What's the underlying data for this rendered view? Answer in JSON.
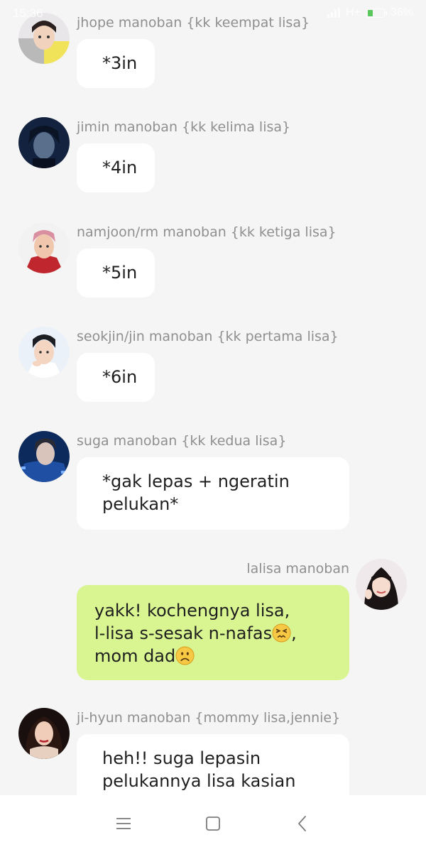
{
  "status_bar": {
    "time": "15:36",
    "network": "H+",
    "battery": "36%",
    "battery_level": 0.36,
    "battery_color": "#3fbf3f"
  },
  "messages": [
    {
      "sender": "jhope manoban {kk keempat lisa}",
      "lines": [
        "*3in"
      ],
      "side": "left",
      "avatar": "avatar-jhope"
    },
    {
      "sender": "jimin manoban {kk kelima lisa}",
      "lines": [
        "*4in"
      ],
      "side": "left",
      "avatar": "avatar-jimin"
    },
    {
      "sender": "namjoon/rm manoban {kk ketiga lisa}",
      "lines": [
        "*5in"
      ],
      "side": "left",
      "avatar": "avatar-namjoon"
    },
    {
      "sender": "seokjin/jin manoban {kk pertama lisa}",
      "lines": [
        "*6in"
      ],
      "side": "left",
      "avatar": "avatar-seokjin"
    },
    {
      "sender": "suga manoban {kk kedua lisa}",
      "lines": [
        "*gak lepas + ngeratin",
        "pelukan*"
      ],
      "side": "left",
      "avatar": "avatar-suga"
    },
    {
      "sender": "lalisa manoban",
      "lines": [
        "yakk! kochengnya lisa,",
        "l-lisa s-sesak n-nafas",
        ",",
        "mom dad"
      ],
      "emojis": [
        "persevering-face-emoji",
        "frowning-face-emoji"
      ],
      "side": "right",
      "avatar": "avatar-lalisa"
    },
    {
      "sender": "ji-hyun manoban {mommy lisa,jennie}",
      "lines": [
        "heh!! suga lepasin",
        "pelukannya lisa kasian"
      ],
      "side": "left",
      "avatar": "avatar-jihyun"
    }
  ],
  "colors": {
    "background": "#f5f5f5",
    "incoming_bubble": "#ffffff",
    "outgoing_bubble": "#d9f591",
    "sender_text": "#8f8f8f",
    "message_text": "#1f1f1f"
  },
  "nav_bar": {
    "buttons": [
      "menu-icon",
      "home-icon",
      "back-icon"
    ]
  }
}
